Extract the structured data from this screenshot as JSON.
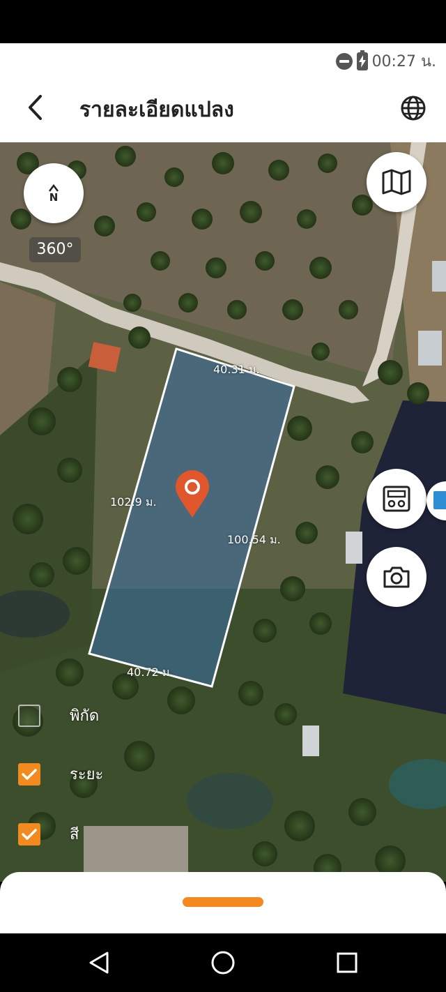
{
  "status_bar": {
    "time": "00:27 น."
  },
  "header": {
    "title": "รายละเอียดแปลง"
  },
  "map": {
    "compass_label": "N",
    "degree": "360°",
    "dimensions": {
      "top": "40.31 ม.",
      "left": "102.9 ม.",
      "right": "100.54 ม.",
      "bottom": "40.72 ม."
    }
  },
  "layers": [
    {
      "label": "พิกัด",
      "checked": false
    },
    {
      "label": "ระยะ",
      "checked": true
    },
    {
      "label": "สี",
      "checked": true
    }
  ],
  "colors": {
    "accent": "#f28a1f",
    "pin": "#e2562c",
    "plot_fill": "#3a6fa8"
  },
  "icons": [
    "back-arrow-icon",
    "globe-icon",
    "map-icon",
    "calculator-icon",
    "camera-icon",
    "cube-icon",
    "location-pin-icon"
  ]
}
